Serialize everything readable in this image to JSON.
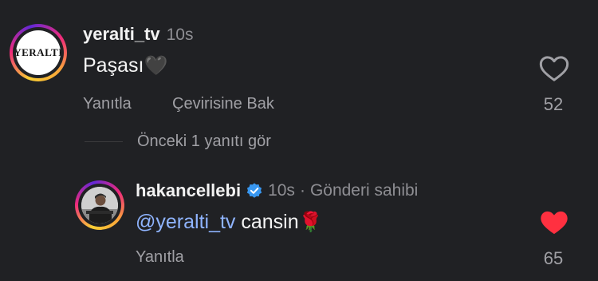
{
  "comment1": {
    "username": "yeralti_tv",
    "time": "10s",
    "avatar_text": "YERALTI",
    "text": "Paşası",
    "emoji": "🖤",
    "actions": {
      "reply": "Yanıtla",
      "translate": "Çevirisine Bak"
    },
    "like_count": "52",
    "liked": false
  },
  "view_previous": "Önceki 1 yanıtı gör",
  "comment2": {
    "username": "hakancellebi",
    "verified": true,
    "time": "10s",
    "separator": "·",
    "role": "Gönderi sahibi",
    "mention": "@yeralti_tv",
    "text": "cansin",
    "emoji": "🌹",
    "actions": {
      "reply": "Yanıtla"
    },
    "like_count": "65",
    "liked": true
  },
  "colors": {
    "background": "#202124",
    "mention": "#8fb4ff",
    "verified": "#3897f0",
    "liked_heart": "#ff3040"
  }
}
